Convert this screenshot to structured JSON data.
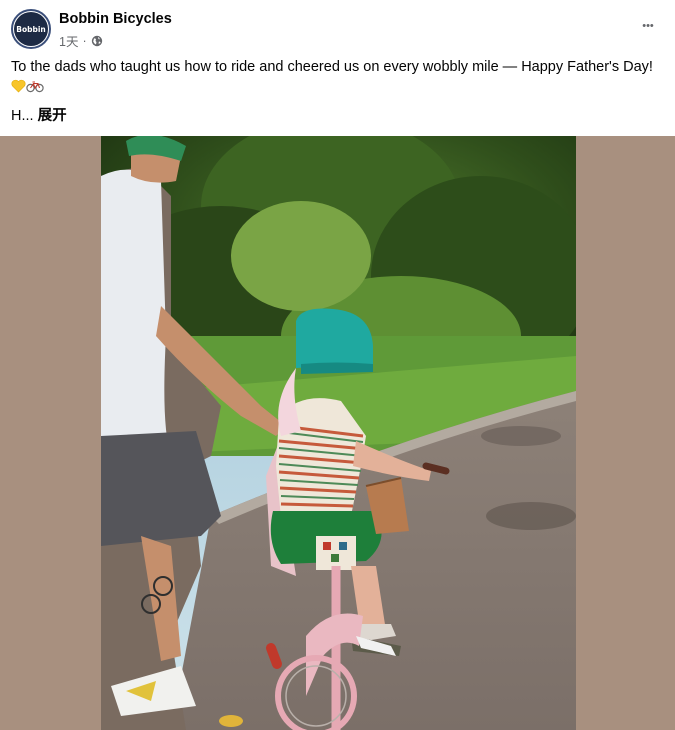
{
  "post": {
    "page_name": "Bobbin Bicycles",
    "avatar_text": "Bobbin",
    "time": "1天",
    "caption_text": "To the dads who taught us how to ride and cheered us on every wobbly mile — Happy Father's Day!",
    "truncated_text": "H...",
    "expand_label": "展开",
    "more_label": "•••"
  },
  "icons": [
    "globe-icon",
    "more-icon",
    "yellow-heart-emoji",
    "bicycle-emoji"
  ],
  "colors": {
    "avatar_ring": "#3b4f7a",
    "avatar_bg": "#1d2a44",
    "photo_backdrop": "#a8907f",
    "meta_text": "#65676b"
  }
}
